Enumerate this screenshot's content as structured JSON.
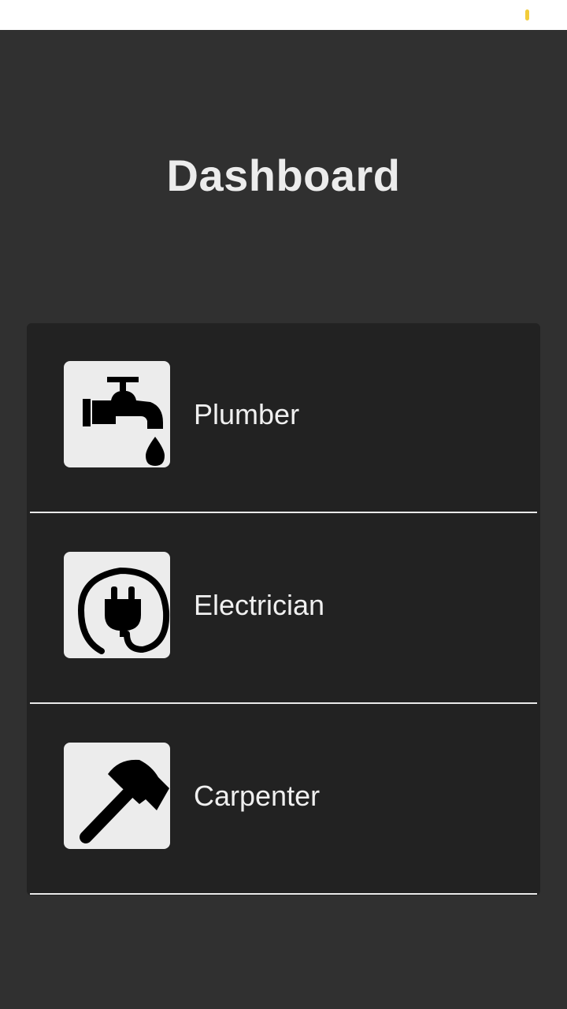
{
  "page": {
    "title": "Dashboard"
  },
  "colors": {
    "background": "#303030",
    "card": "#222222",
    "text": "#f0f0f0",
    "icon_tile": "#ececec",
    "status_indicator": "#f2cc3a"
  },
  "services": [
    {
      "label": "Plumber",
      "icon": "faucet-icon"
    },
    {
      "label": "Electrician",
      "icon": "plug-icon"
    },
    {
      "label": "Carpenter",
      "icon": "hammer-icon"
    }
  ]
}
